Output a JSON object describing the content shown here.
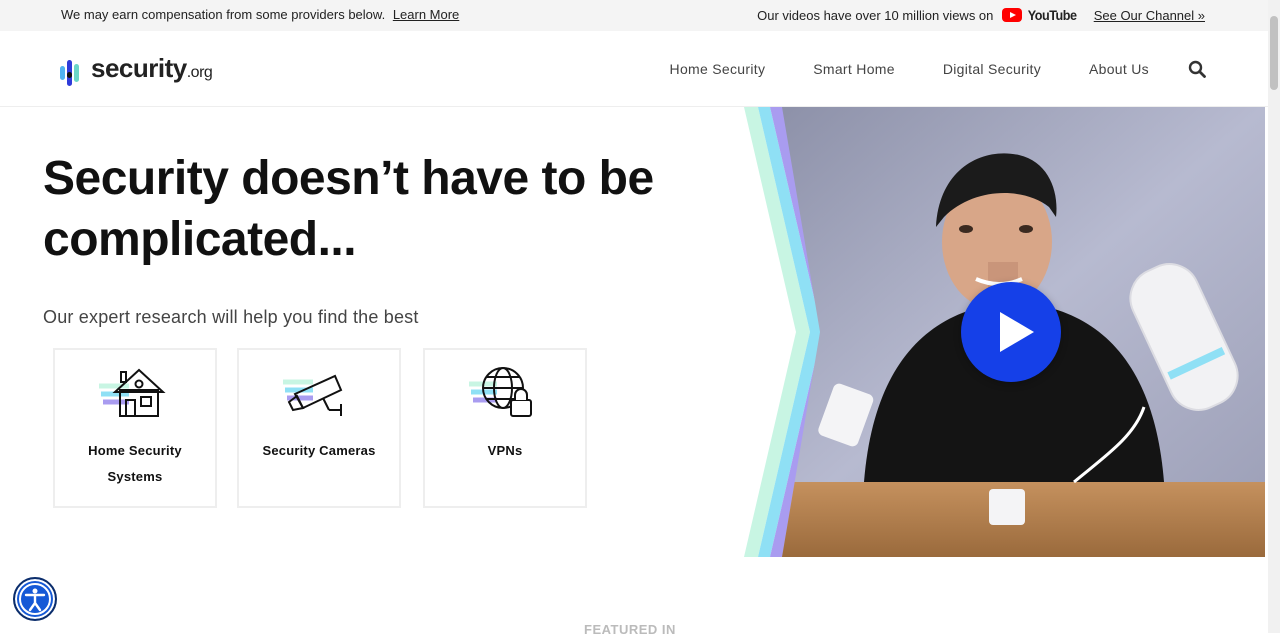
{
  "topbar": {
    "disclosure": "We may earn compensation from some providers below.",
    "learn_more": "Learn More",
    "views_text": "Our videos have over 10 million views on",
    "youtube_label": "YouTube",
    "channel_link": "See Our Channel »"
  },
  "header": {
    "logo_main": "security",
    "logo_suffix": ".org",
    "nav": [
      "Home Security",
      "Smart Home",
      "Digital Security",
      "About Us"
    ]
  },
  "hero": {
    "title": "Security doesn’t have to be complicated...",
    "subtitle": "Our expert research will help you find the best",
    "cards": [
      {
        "label_line1": "Home Security",
        "label_line2": "Systems",
        "icon": "house-icon"
      },
      {
        "label_line1": "Security Cameras",
        "label_line2": "",
        "icon": "security-camera-icon"
      },
      {
        "label_line1": "VPNs",
        "label_line2": "",
        "icon": "globe-lock-icon"
      }
    ]
  },
  "featured_label": "FEATURED IN",
  "colors": {
    "accent_blue": "#1540e8",
    "youtube_red": "#ff0000",
    "stripe_mint": "#c8f5e3",
    "stripe_cyan": "#8fe0f5",
    "stripe_purple": "#a99cf0",
    "a11y_blue": "#1559d6"
  }
}
